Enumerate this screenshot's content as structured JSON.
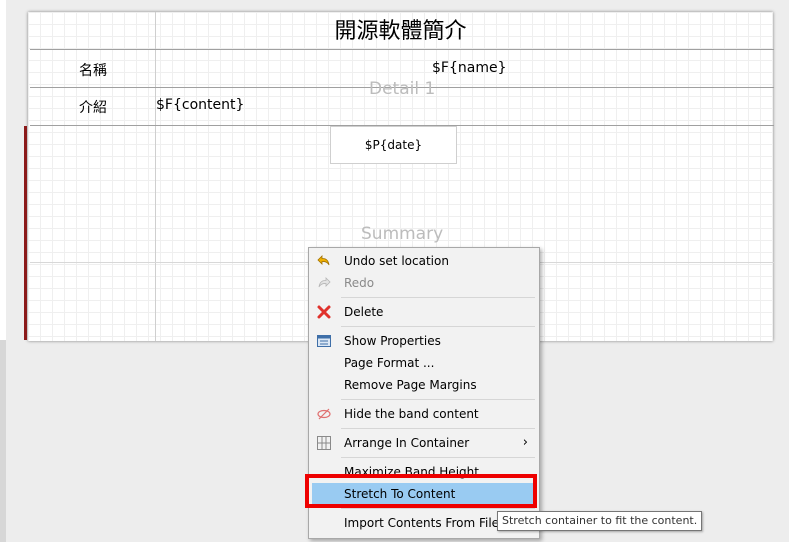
{
  "report": {
    "title": "開源軟體簡介",
    "rows": [
      {
        "label": "名稱",
        "field": "$F{name}"
      },
      {
        "label": "介紹",
        "field": "$F{content}"
      }
    ],
    "date_field": "$P{date}",
    "bands": {
      "detail": "Detail 1",
      "summary": "Summary"
    }
  },
  "context_menu": {
    "items": [
      {
        "label": "Undo set location",
        "icon": "undo-icon",
        "enabled": true
      },
      {
        "label": "Redo",
        "icon": "redo-icon",
        "enabled": false
      },
      {
        "label": "Delete",
        "icon": "delete-icon",
        "enabled": true
      },
      {
        "label": "Show Properties",
        "icon": "properties-icon",
        "enabled": true
      },
      {
        "label": "Page Format ...",
        "enabled": true
      },
      {
        "label": "Remove Page Margins",
        "enabled": true
      },
      {
        "label": "Hide the band content",
        "icon": "hide-icon",
        "enabled": true
      },
      {
        "label": "Arrange In Container",
        "icon": "grid-icon",
        "enabled": true,
        "submenu": true
      },
      {
        "label": "Maximize Band Height",
        "enabled": true
      },
      {
        "label": "Stretch To Content",
        "enabled": true,
        "selected": true
      },
      {
        "label": "Import Contents From File",
        "enabled": true
      }
    ]
  },
  "tooltip": {
    "text": "Stretch container to fit the content."
  },
  "colors": {
    "highlight_border": "#ee0000",
    "menu_selected": "#99cbf2",
    "band_marker": "#8b1a1a"
  }
}
